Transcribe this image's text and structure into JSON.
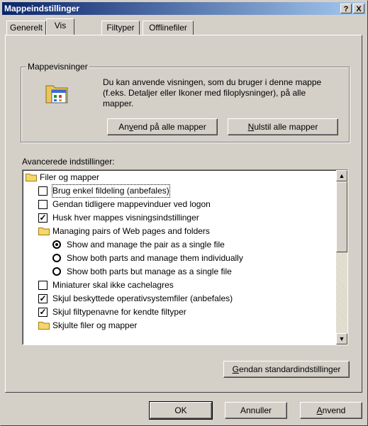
{
  "window": {
    "title": "Mappeindstillinger",
    "help_button": "?",
    "close_button": "X"
  },
  "tabs": [
    {
      "label": "Generelt",
      "active": false
    },
    {
      "label": "Vis",
      "active": true
    },
    {
      "label": "Filtyper",
      "active": false
    },
    {
      "label": "Offlinefiler",
      "active": false
    }
  ],
  "folder_views": {
    "legend": "Mappevisninger",
    "description": "Du kan anvende visningen, som du bruger i denne mappe (f.eks. Detaljer eller Ikoner med filoplysninger), på alle mapper.",
    "apply_button": {
      "pre": "An",
      "key": "v",
      "post": "end på alle mapper"
    },
    "reset_button": {
      "pre": "",
      "key": "N",
      "post": "ulstil alle mapper"
    }
  },
  "advanced": {
    "label": "Avancerede indstillinger:",
    "items": [
      {
        "type": "folder",
        "label": "Filer og mapper",
        "level": 0
      },
      {
        "type": "checkbox",
        "label": "Brug enkel fildeling (anbefales)",
        "checked": false,
        "level": 1,
        "focused": true
      },
      {
        "type": "checkbox",
        "label": "Gendan tidligere mappevinduer ved logon",
        "checked": false,
        "level": 1
      },
      {
        "type": "checkbox",
        "label": "Husk hver mappes visningsindstillinger",
        "checked": true,
        "level": 1
      },
      {
        "type": "folder",
        "label": "Managing pairs of Web pages and folders",
        "level": 1
      },
      {
        "type": "radio",
        "label": "Show and manage the pair as a single file",
        "checked": true,
        "level": 2
      },
      {
        "type": "radio",
        "label": "Show both parts and manage them individually",
        "checked": false,
        "level": 2
      },
      {
        "type": "radio",
        "label": "Show both parts but manage as a single file",
        "checked": false,
        "level": 2
      },
      {
        "type": "checkbox",
        "label": "Miniaturer skal ikke cachelagres",
        "checked": false,
        "level": 1
      },
      {
        "type": "checkbox",
        "label": "Skjul beskyttede operativsystemfiler (anbefales)",
        "checked": true,
        "level": 1
      },
      {
        "type": "checkbox",
        "label": "Skjul filtypenavne for kendte filtyper",
        "checked": true,
        "level": 1
      },
      {
        "type": "folder",
        "label": "Skjulte filer og mapper",
        "level": 1
      }
    ],
    "restore_button": {
      "pre": "",
      "key": "G",
      "post": "endan standardindstillinger"
    }
  },
  "footer": {
    "ok": "OK",
    "cancel": "Annuller",
    "apply": {
      "pre": "",
      "key": "A",
      "post": "nvend"
    }
  },
  "colors": {
    "title_start": "#0a246a",
    "title_end": "#a6caf0",
    "face": "#d4d0c8"
  }
}
